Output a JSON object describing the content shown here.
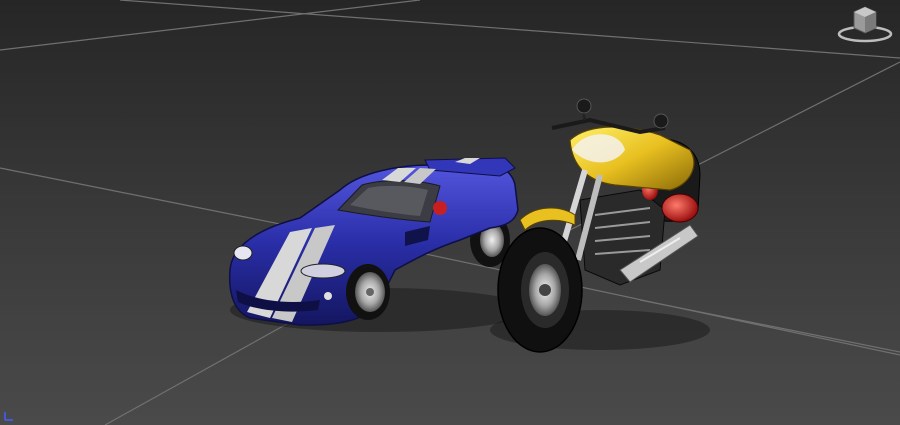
{
  "viewport": {
    "label": "",
    "background_top": "#2a2a2a",
    "background_bottom": "#4b4b4b",
    "grid_color": "#7a7a7a"
  },
  "scene": {
    "objects": [
      {
        "id": "sports-car",
        "body_color": "#2a2ea8",
        "stripe_color": "#d8d8d8",
        "wheel_color": "#bdbdbd"
      },
      {
        "id": "motorcycle",
        "body_color": "#e8c020",
        "frame_color": "#1a1a1a",
        "accent_color": "#d82020",
        "chrome_color": "#c8c8c8"
      }
    ]
  },
  "viewcube": {
    "icon": "viewcube-icon"
  },
  "axis_tripod": {
    "icon": "axis-tripod-icon"
  }
}
